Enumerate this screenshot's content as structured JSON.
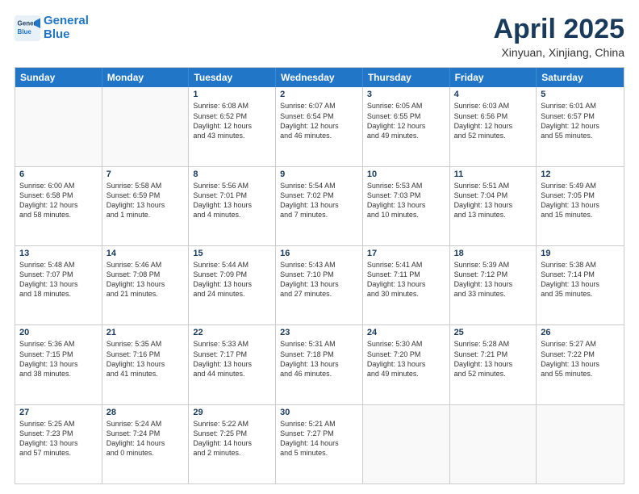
{
  "header": {
    "logo_line1": "General",
    "logo_line2": "Blue",
    "month": "April 2025",
    "location": "Xinyuan, Xinjiang, China"
  },
  "days_of_week": [
    "Sunday",
    "Monday",
    "Tuesday",
    "Wednesday",
    "Thursday",
    "Friday",
    "Saturday"
  ],
  "rows": [
    [
      {
        "day": "",
        "empty": true
      },
      {
        "day": "",
        "empty": true
      },
      {
        "day": "1",
        "line1": "Sunrise: 6:08 AM",
        "line2": "Sunset: 6:52 PM",
        "line3": "Daylight: 12 hours",
        "line4": "and 43 minutes."
      },
      {
        "day": "2",
        "line1": "Sunrise: 6:07 AM",
        "line2": "Sunset: 6:54 PM",
        "line3": "Daylight: 12 hours",
        "line4": "and 46 minutes."
      },
      {
        "day": "3",
        "line1": "Sunrise: 6:05 AM",
        "line2": "Sunset: 6:55 PM",
        "line3": "Daylight: 12 hours",
        "line4": "and 49 minutes."
      },
      {
        "day": "4",
        "line1": "Sunrise: 6:03 AM",
        "line2": "Sunset: 6:56 PM",
        "line3": "Daylight: 12 hours",
        "line4": "and 52 minutes."
      },
      {
        "day": "5",
        "line1": "Sunrise: 6:01 AM",
        "line2": "Sunset: 6:57 PM",
        "line3": "Daylight: 12 hours",
        "line4": "and 55 minutes."
      }
    ],
    [
      {
        "day": "6",
        "line1": "Sunrise: 6:00 AM",
        "line2": "Sunset: 6:58 PM",
        "line3": "Daylight: 12 hours",
        "line4": "and 58 minutes."
      },
      {
        "day": "7",
        "line1": "Sunrise: 5:58 AM",
        "line2": "Sunset: 6:59 PM",
        "line3": "Daylight: 13 hours",
        "line4": "and 1 minute."
      },
      {
        "day": "8",
        "line1": "Sunrise: 5:56 AM",
        "line2": "Sunset: 7:01 PM",
        "line3": "Daylight: 13 hours",
        "line4": "and 4 minutes."
      },
      {
        "day": "9",
        "line1": "Sunrise: 5:54 AM",
        "line2": "Sunset: 7:02 PM",
        "line3": "Daylight: 13 hours",
        "line4": "and 7 minutes."
      },
      {
        "day": "10",
        "line1": "Sunrise: 5:53 AM",
        "line2": "Sunset: 7:03 PM",
        "line3": "Daylight: 13 hours",
        "line4": "and 10 minutes."
      },
      {
        "day": "11",
        "line1": "Sunrise: 5:51 AM",
        "line2": "Sunset: 7:04 PM",
        "line3": "Daylight: 13 hours",
        "line4": "and 13 minutes."
      },
      {
        "day": "12",
        "line1": "Sunrise: 5:49 AM",
        "line2": "Sunset: 7:05 PM",
        "line3": "Daylight: 13 hours",
        "line4": "and 15 minutes."
      }
    ],
    [
      {
        "day": "13",
        "line1": "Sunrise: 5:48 AM",
        "line2": "Sunset: 7:07 PM",
        "line3": "Daylight: 13 hours",
        "line4": "and 18 minutes."
      },
      {
        "day": "14",
        "line1": "Sunrise: 5:46 AM",
        "line2": "Sunset: 7:08 PM",
        "line3": "Daylight: 13 hours",
        "line4": "and 21 minutes."
      },
      {
        "day": "15",
        "line1": "Sunrise: 5:44 AM",
        "line2": "Sunset: 7:09 PM",
        "line3": "Daylight: 13 hours",
        "line4": "and 24 minutes."
      },
      {
        "day": "16",
        "line1": "Sunrise: 5:43 AM",
        "line2": "Sunset: 7:10 PM",
        "line3": "Daylight: 13 hours",
        "line4": "and 27 minutes."
      },
      {
        "day": "17",
        "line1": "Sunrise: 5:41 AM",
        "line2": "Sunset: 7:11 PM",
        "line3": "Daylight: 13 hours",
        "line4": "and 30 minutes."
      },
      {
        "day": "18",
        "line1": "Sunrise: 5:39 AM",
        "line2": "Sunset: 7:12 PM",
        "line3": "Daylight: 13 hours",
        "line4": "and 33 minutes."
      },
      {
        "day": "19",
        "line1": "Sunrise: 5:38 AM",
        "line2": "Sunset: 7:14 PM",
        "line3": "Daylight: 13 hours",
        "line4": "and 35 minutes."
      }
    ],
    [
      {
        "day": "20",
        "line1": "Sunrise: 5:36 AM",
        "line2": "Sunset: 7:15 PM",
        "line3": "Daylight: 13 hours",
        "line4": "and 38 minutes."
      },
      {
        "day": "21",
        "line1": "Sunrise: 5:35 AM",
        "line2": "Sunset: 7:16 PM",
        "line3": "Daylight: 13 hours",
        "line4": "and 41 minutes."
      },
      {
        "day": "22",
        "line1": "Sunrise: 5:33 AM",
        "line2": "Sunset: 7:17 PM",
        "line3": "Daylight: 13 hours",
        "line4": "and 44 minutes."
      },
      {
        "day": "23",
        "line1": "Sunrise: 5:31 AM",
        "line2": "Sunset: 7:18 PM",
        "line3": "Daylight: 13 hours",
        "line4": "and 46 minutes."
      },
      {
        "day": "24",
        "line1": "Sunrise: 5:30 AM",
        "line2": "Sunset: 7:20 PM",
        "line3": "Daylight: 13 hours",
        "line4": "and 49 minutes."
      },
      {
        "day": "25",
        "line1": "Sunrise: 5:28 AM",
        "line2": "Sunset: 7:21 PM",
        "line3": "Daylight: 13 hours",
        "line4": "and 52 minutes."
      },
      {
        "day": "26",
        "line1": "Sunrise: 5:27 AM",
        "line2": "Sunset: 7:22 PM",
        "line3": "Daylight: 13 hours",
        "line4": "and 55 minutes."
      }
    ],
    [
      {
        "day": "27",
        "line1": "Sunrise: 5:25 AM",
        "line2": "Sunset: 7:23 PM",
        "line3": "Daylight: 13 hours",
        "line4": "and 57 minutes."
      },
      {
        "day": "28",
        "line1": "Sunrise: 5:24 AM",
        "line2": "Sunset: 7:24 PM",
        "line3": "Daylight: 14 hours",
        "line4": "and 0 minutes."
      },
      {
        "day": "29",
        "line1": "Sunrise: 5:22 AM",
        "line2": "Sunset: 7:25 PM",
        "line3": "Daylight: 14 hours",
        "line4": "and 2 minutes."
      },
      {
        "day": "30",
        "line1": "Sunrise: 5:21 AM",
        "line2": "Sunset: 7:27 PM",
        "line3": "Daylight: 14 hours",
        "line4": "and 5 minutes."
      },
      {
        "day": "",
        "empty": true
      },
      {
        "day": "",
        "empty": true
      },
      {
        "day": "",
        "empty": true
      }
    ]
  ]
}
